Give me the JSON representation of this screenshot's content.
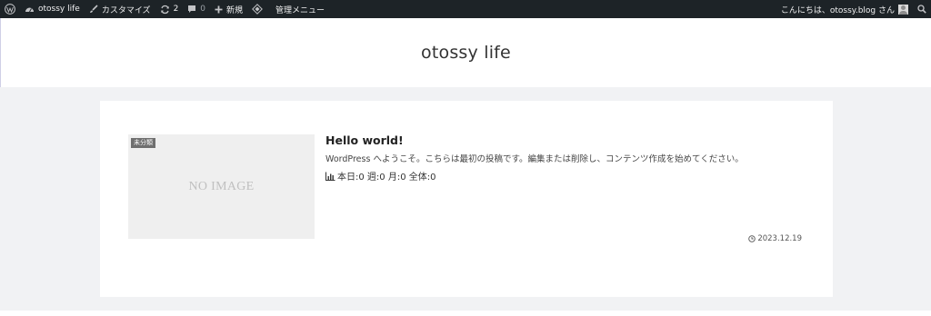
{
  "adminbar": {
    "site_name": "otossy life",
    "customize": "カスタマイズ",
    "updates": "2",
    "comments": "0",
    "new": "新規",
    "admin_menu": "管理メニュー",
    "greeting": "こんにちは、otossy.blog さん"
  },
  "site": {
    "title": "otossy life"
  },
  "post": {
    "category": "未分類",
    "no_image": "NO IMAGE",
    "title": "Hello world!",
    "excerpt": "WordPress へようこそ。こちらは最初の投稿です。編集または削除し、コンテンツ作成を始めてください。",
    "stats": "本日:0  週:0  月:0  全体:0",
    "date": "2023.12.19"
  },
  "colors": {
    "adminbar_bg": "#1d2327",
    "page_bg": "#f1f2f4",
    "card_bg": "#ffffff"
  }
}
